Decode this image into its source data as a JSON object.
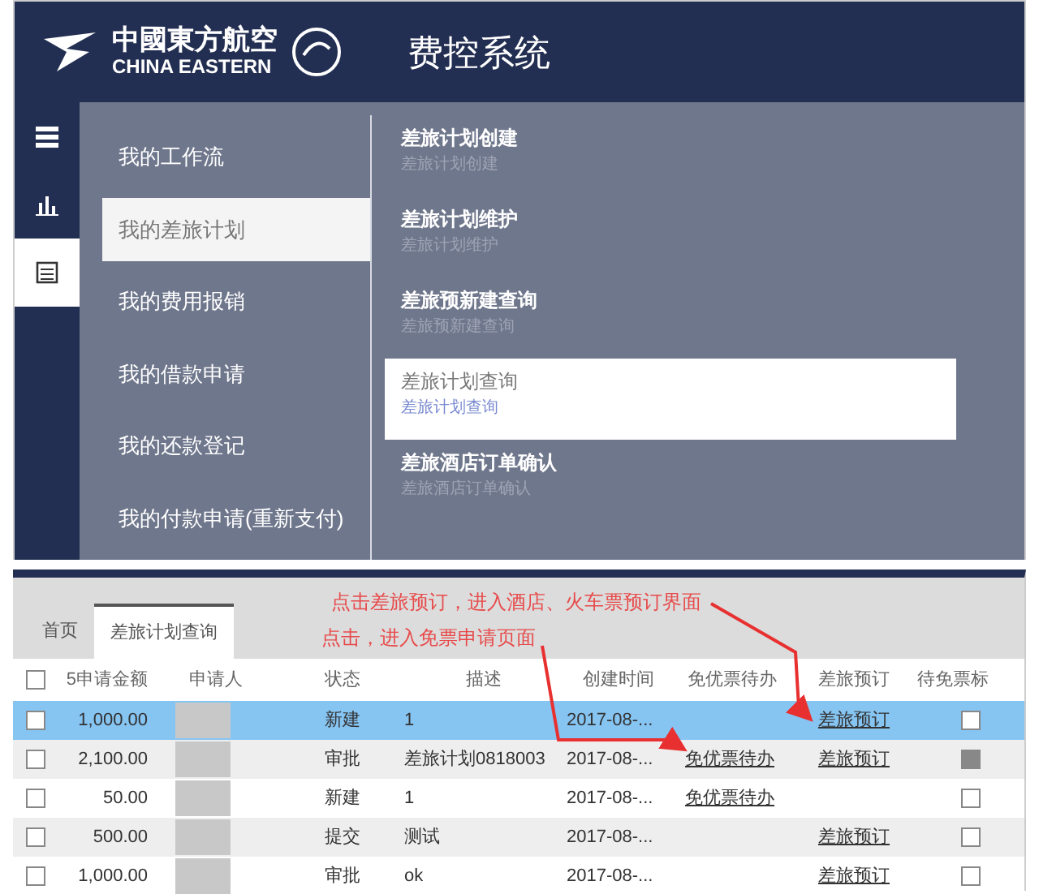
{
  "header": {
    "logo_cn": "中國東方航空",
    "logo_en": "CHINA EASTERN",
    "title": "费控系统"
  },
  "rail": [
    {
      "selected": false
    },
    {
      "selected": false
    },
    {
      "selected": true
    }
  ],
  "menu": {
    "groups": [
      {
        "label": "我的工作流",
        "selected": false
      },
      {
        "label": "我的差旅计划",
        "selected": true
      },
      {
        "label": "我的费用报销",
        "selected": false
      },
      {
        "label": "我的借款申请",
        "selected": false
      },
      {
        "label": "我的还款登记",
        "selected": false
      },
      {
        "label": "我的付款申请(重新支付)",
        "selected": false
      }
    ],
    "items": [
      {
        "title": "差旅计划创建",
        "subtitle": "差旅计划创建",
        "selected": false
      },
      {
        "title": "差旅计划维护",
        "subtitle": "差旅计划维护",
        "selected": false
      },
      {
        "title": "差旅预新建查询",
        "subtitle": "差旅预新建查询",
        "selected": false
      },
      {
        "title": "差旅计划查询",
        "subtitle": "差旅计划查询",
        "selected": true
      },
      {
        "title": "差旅酒店订单确认",
        "subtitle": "差旅酒店订单确认",
        "selected": false
      }
    ]
  },
  "tabs": [
    {
      "label": "首页",
      "selected": false
    },
    {
      "label": "差旅计划查询",
      "selected": true
    }
  ],
  "annotations": [
    {
      "text": "点击差旅预订，进入酒店、火车票预订界面"
    },
    {
      "text": "点击，进入免票申请页面"
    }
  ],
  "table": {
    "all_checked": false,
    "columns": [
      "5申请金额",
      "申请人",
      "状态",
      "描述",
      "创建时间",
      "免优票待办",
      "差旅预订",
      "待免票标"
    ],
    "rows": [
      {
        "checked": false,
        "selected": true,
        "amount": "1,000.00",
        "status": "新建",
        "description": "1",
        "created": "2017-08-...",
        "booking": "差旅预订",
        "marked": false
      },
      {
        "checked": false,
        "selected": false,
        "amount": "2,100.00",
        "status": "审批",
        "description": "差旅计划0818003",
        "created": "2017-08-...",
        "free_ticket": "免优票待办",
        "booking": "差旅预订",
        "marked": true
      },
      {
        "checked": false,
        "selected": false,
        "amount": "50.00",
        "status": "新建",
        "description": "1",
        "created": "2017-08-...",
        "free_ticket": "免优票待办",
        "marked": false
      },
      {
        "checked": false,
        "selected": false,
        "amount": "500.00",
        "status": "提交",
        "description": "测试",
        "created": "2017-08-...",
        "booking": "差旅预订",
        "marked": false
      },
      {
        "checked": false,
        "selected": false,
        "amount": "1,000.00",
        "status": "审批",
        "description": "ok",
        "created": "2017-08-...",
        "booking": "差旅预订",
        "marked": false
      }
    ]
  }
}
